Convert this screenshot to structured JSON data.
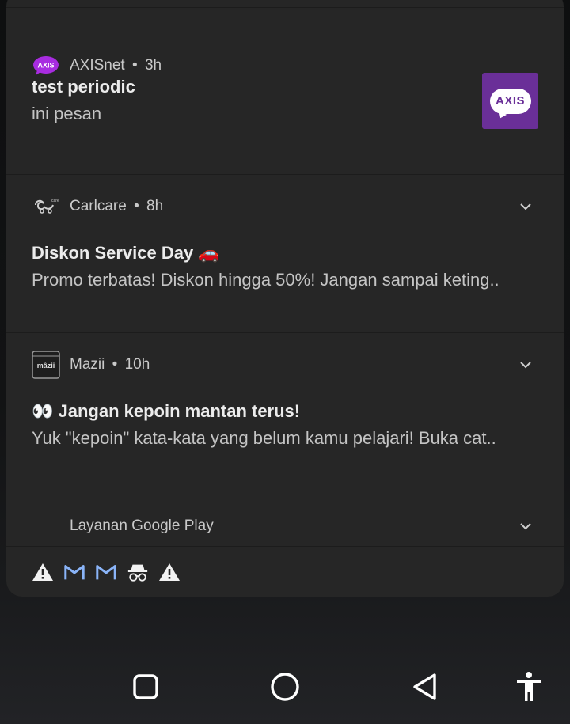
{
  "notifications": [
    {
      "app": "AXISnet",
      "time": "3h",
      "title": "test periodic",
      "body": "ini pesan",
      "icon": "axis-logo-icon",
      "thumbnail_text": "AXIS"
    },
    {
      "app": "Carlcare",
      "time": "8h",
      "title": "Diskon Service Day 🚗",
      "body": "Promo terbatas! Diskon hingga 50%! Jangan sampai keting..",
      "icon": "carlcare-logo-icon"
    },
    {
      "app": "Mazii",
      "time": "10h",
      "title": "👀 Jangan kepoin mantan terus!",
      "body": "Yuk \"kepoin\" kata-kata yang belum kamu pelajari! Buka cat..",
      "icon": "mazii-logo-icon",
      "icon_text": "mâzii"
    },
    {
      "app": "Layanan Google Play"
    }
  ],
  "separator": "•",
  "status_icons": [
    "warning-icon",
    "gmail-icon",
    "gmail-icon",
    "incognito-icon",
    "warning-icon"
  ],
  "colors": {
    "panel": "#262626",
    "axis_purple": "#6a2f98",
    "gmail_blue": "#8ab4f8"
  }
}
